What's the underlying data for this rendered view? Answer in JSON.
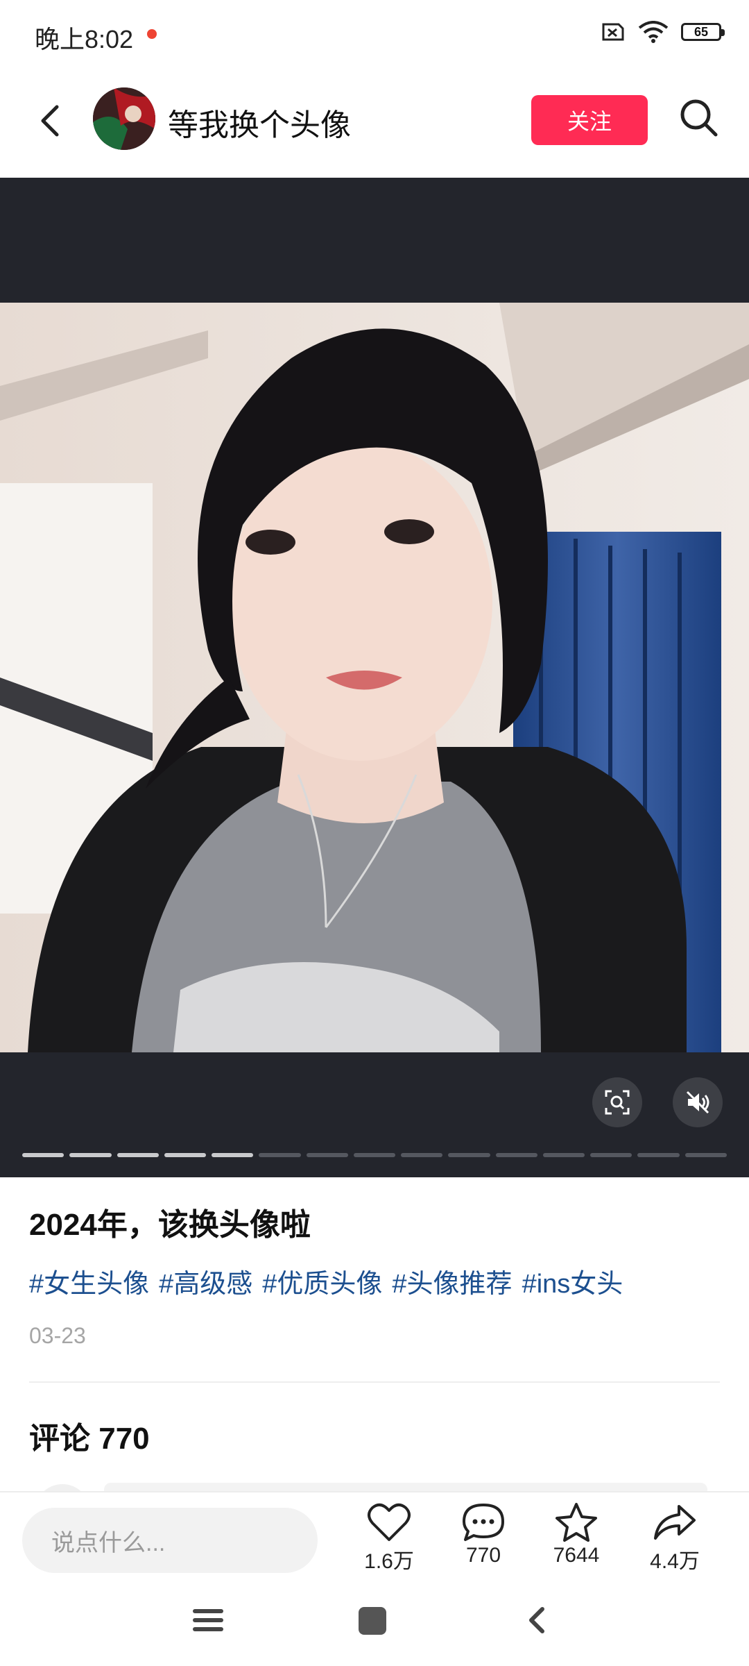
{
  "status_bar": {
    "time": "晚上8:02",
    "battery": "65"
  },
  "header": {
    "author_name": "等我换个头像",
    "follow_label": "关注"
  },
  "media": {
    "slide_count": 15,
    "current_slide_index": 5
  },
  "post": {
    "title": "2024年，该换头像啦",
    "tags": [
      "#女生头像",
      "#高级感",
      "#优质头像",
      "#头像推荐",
      "#ins女头"
    ],
    "date": "03-23"
  },
  "comments": {
    "header": "评论 770"
  },
  "bottom_bar": {
    "input_placeholder": "说点什么...",
    "likes": "1.6万",
    "comments": "770",
    "favorites": "7644",
    "shares": "4.4万"
  },
  "colors": {
    "follow_button": "#ff2b54",
    "tag": "#1c4f8f",
    "media_bg": "#23252c"
  },
  "icons": [
    "back-arrow-icon",
    "search-icon",
    "scan-icon",
    "mute-icon",
    "heart-icon",
    "comment-icon",
    "star-icon",
    "share-icon",
    "menu-icon",
    "home-icon",
    "back-icon"
  ]
}
